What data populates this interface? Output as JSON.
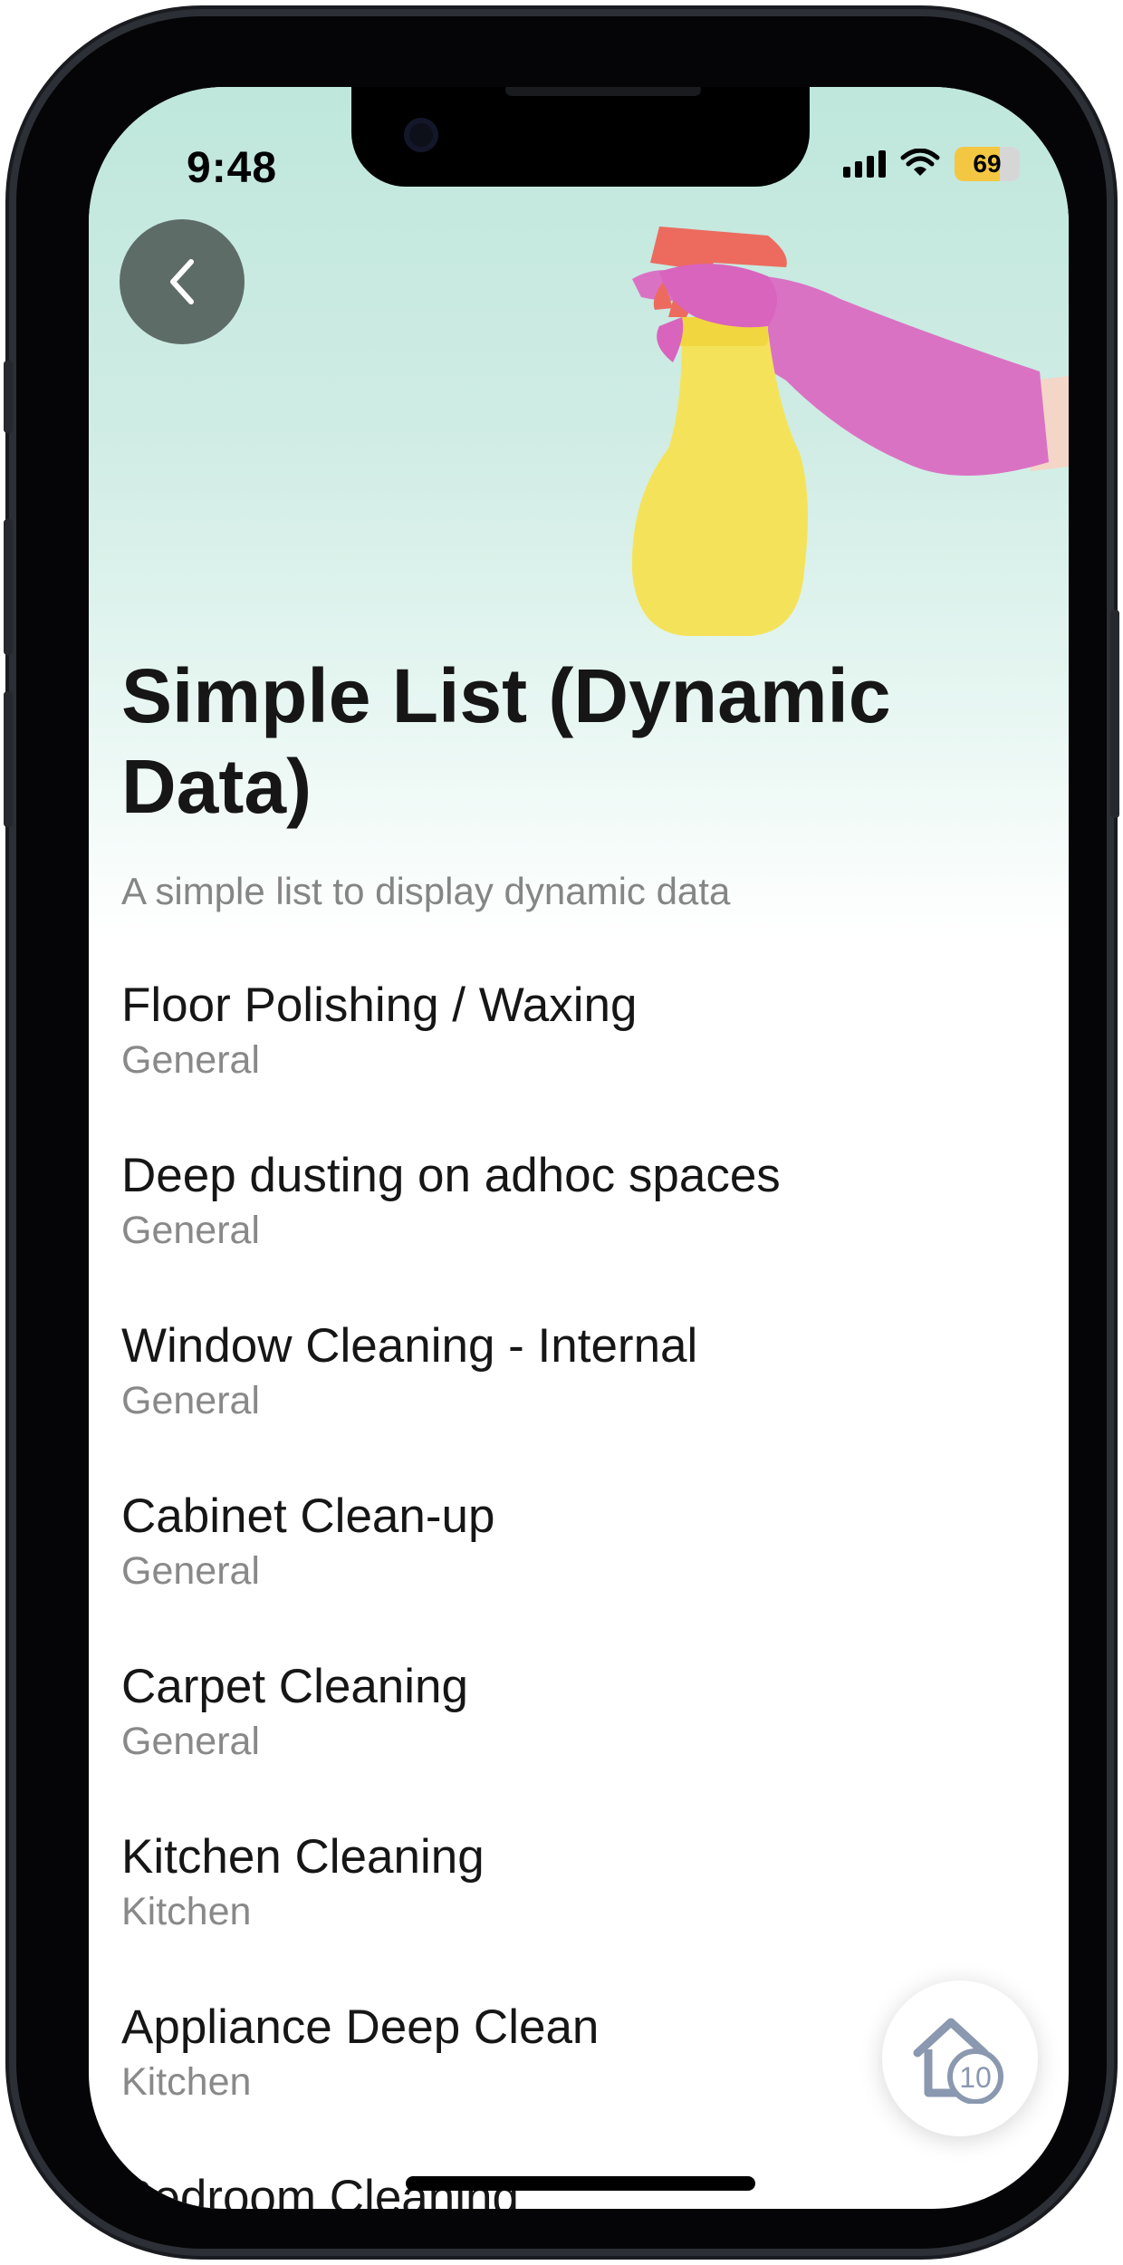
{
  "status_bar": {
    "time": "9:48",
    "battery": "69",
    "battery_level": 0.69,
    "battery_color": "#f3c742"
  },
  "header": {
    "back_icon": "chevron-left-icon",
    "hero_image": "spray-bottle-glove-illustration"
  },
  "page": {
    "title": "Simple List (Dynamic Data)",
    "subtitle": "A simple list to display dynamic data"
  },
  "list": {
    "items": [
      {
        "title": "Floor Polishing / Waxing",
        "category": "General"
      },
      {
        "title": "Deep dusting on adhoc spaces",
        "category": "General"
      },
      {
        "title": "Window Cleaning - Internal",
        "category": "General"
      },
      {
        "title": "Cabinet Clean-up",
        "category": "General"
      },
      {
        "title": "Carpet Cleaning",
        "category": "General"
      },
      {
        "title": "Kitchen Cleaning",
        "category": "Kitchen"
      },
      {
        "title": "Appliance Deep Clean",
        "category": "Kitchen"
      },
      {
        "title": "Bedroom Cleaning",
        "category": ""
      }
    ]
  },
  "fab": {
    "icon": "home-badge-icon",
    "badge": "10"
  }
}
